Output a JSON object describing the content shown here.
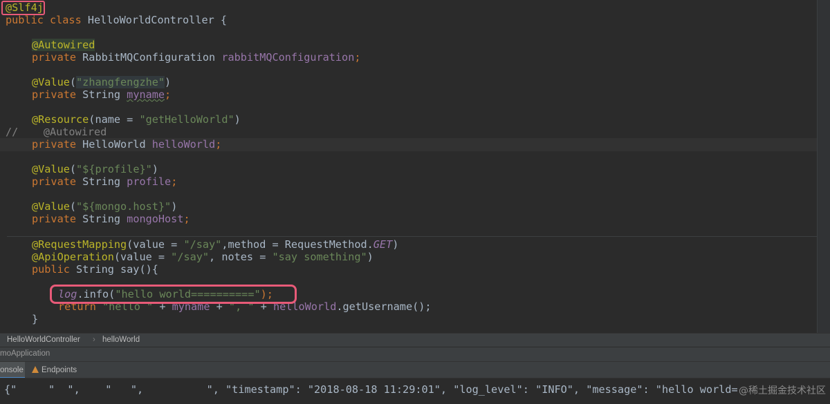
{
  "editor": {
    "lines": [
      {
        "t0": "@Slf4j"
      },
      {
        "kw": "public class ",
        "name": "HelloWorldController",
        "rest": " {"
      },
      {
        "ann": "@Autowired"
      },
      {
        "kw": "private ",
        "type": "RabbitMQConfiguration ",
        "field": "rabbitMQConfiguration",
        "end": ";"
      },
      {
        "ann": "@Value",
        "p1": "(",
        "str": "\"zhangfengzhe\"",
        "p2": ")"
      },
      {
        "kw": "private ",
        "type": "String ",
        "field": "myname",
        "end": ";"
      },
      {
        "ann": "@Resource",
        "p1": "(name = ",
        "str": "\"getHelloWorld\"",
        "p2": ")"
      },
      {
        "cmt": "//    @Autowired"
      },
      {
        "kw": "private ",
        "type": "HelloWorld ",
        "field": "helloWorld",
        "end": ";"
      },
      {
        "ann": "@Value",
        "p1": "(",
        "str": "\"${profile}\"",
        "p2": ")"
      },
      {
        "kw": "private ",
        "type": "String ",
        "field": "profile",
        "end": ";"
      },
      {
        "ann": "@Value",
        "p1": "(",
        "str": "\"${mongo.host}\"",
        "p2": ")"
      },
      {
        "kw": "private ",
        "type": "String ",
        "field": "mongoHost",
        "end": ";"
      },
      {
        "ann": "@RequestMapping",
        "p1": "(value = ",
        "str": "\"/say\"",
        "p2": ",method = RequestMethod.",
        "field": "GET",
        "p3": ")"
      },
      {
        "ann": "@ApiOperation",
        "p1": "(value = ",
        "str": "\"/say\"",
        "p2": ", notes = ",
        "str2": "\"say something\"",
        "p3": ")"
      },
      {
        "kw": "public ",
        "type": "String say(){"
      },
      {
        "field": "log",
        "rest": ".info(",
        "str": "\"hello world==========\"",
        "end": ");"
      },
      {
        "kw": "return ",
        "str": "\"hello \"",
        "p1": " + ",
        "field": "myname",
        "p2": " + ",
        "str2": "\", \"",
        "p3": " + ",
        "field2": "helloWorld",
        "rest": ".getUsername();"
      },
      {
        "rest": "}"
      }
    ]
  },
  "breadcrumb": {
    "class": "HelloWorldController",
    "member": "helloWorld"
  },
  "run_config": "moApplication",
  "tool_tabs": [
    {
      "label": "onsole"
    },
    {
      "label": "Endpoints"
    }
  ],
  "console": {
    "line": "{\"     \"  \",    \"   \",          \", \"timestamp\": \"2018-08-18 11:29:01\", \"log_level\": \"INFO\", \"message\": \"hello world="
  },
  "watermark": "@稀土掘金技术社区",
  "colors": {
    "editor_bg": "#2b2b2b",
    "keyword": "#cc7832",
    "annotation": "#bbb529",
    "string": "#6a8759",
    "field": "#9876aa",
    "highlight_box": "#e85a78"
  }
}
